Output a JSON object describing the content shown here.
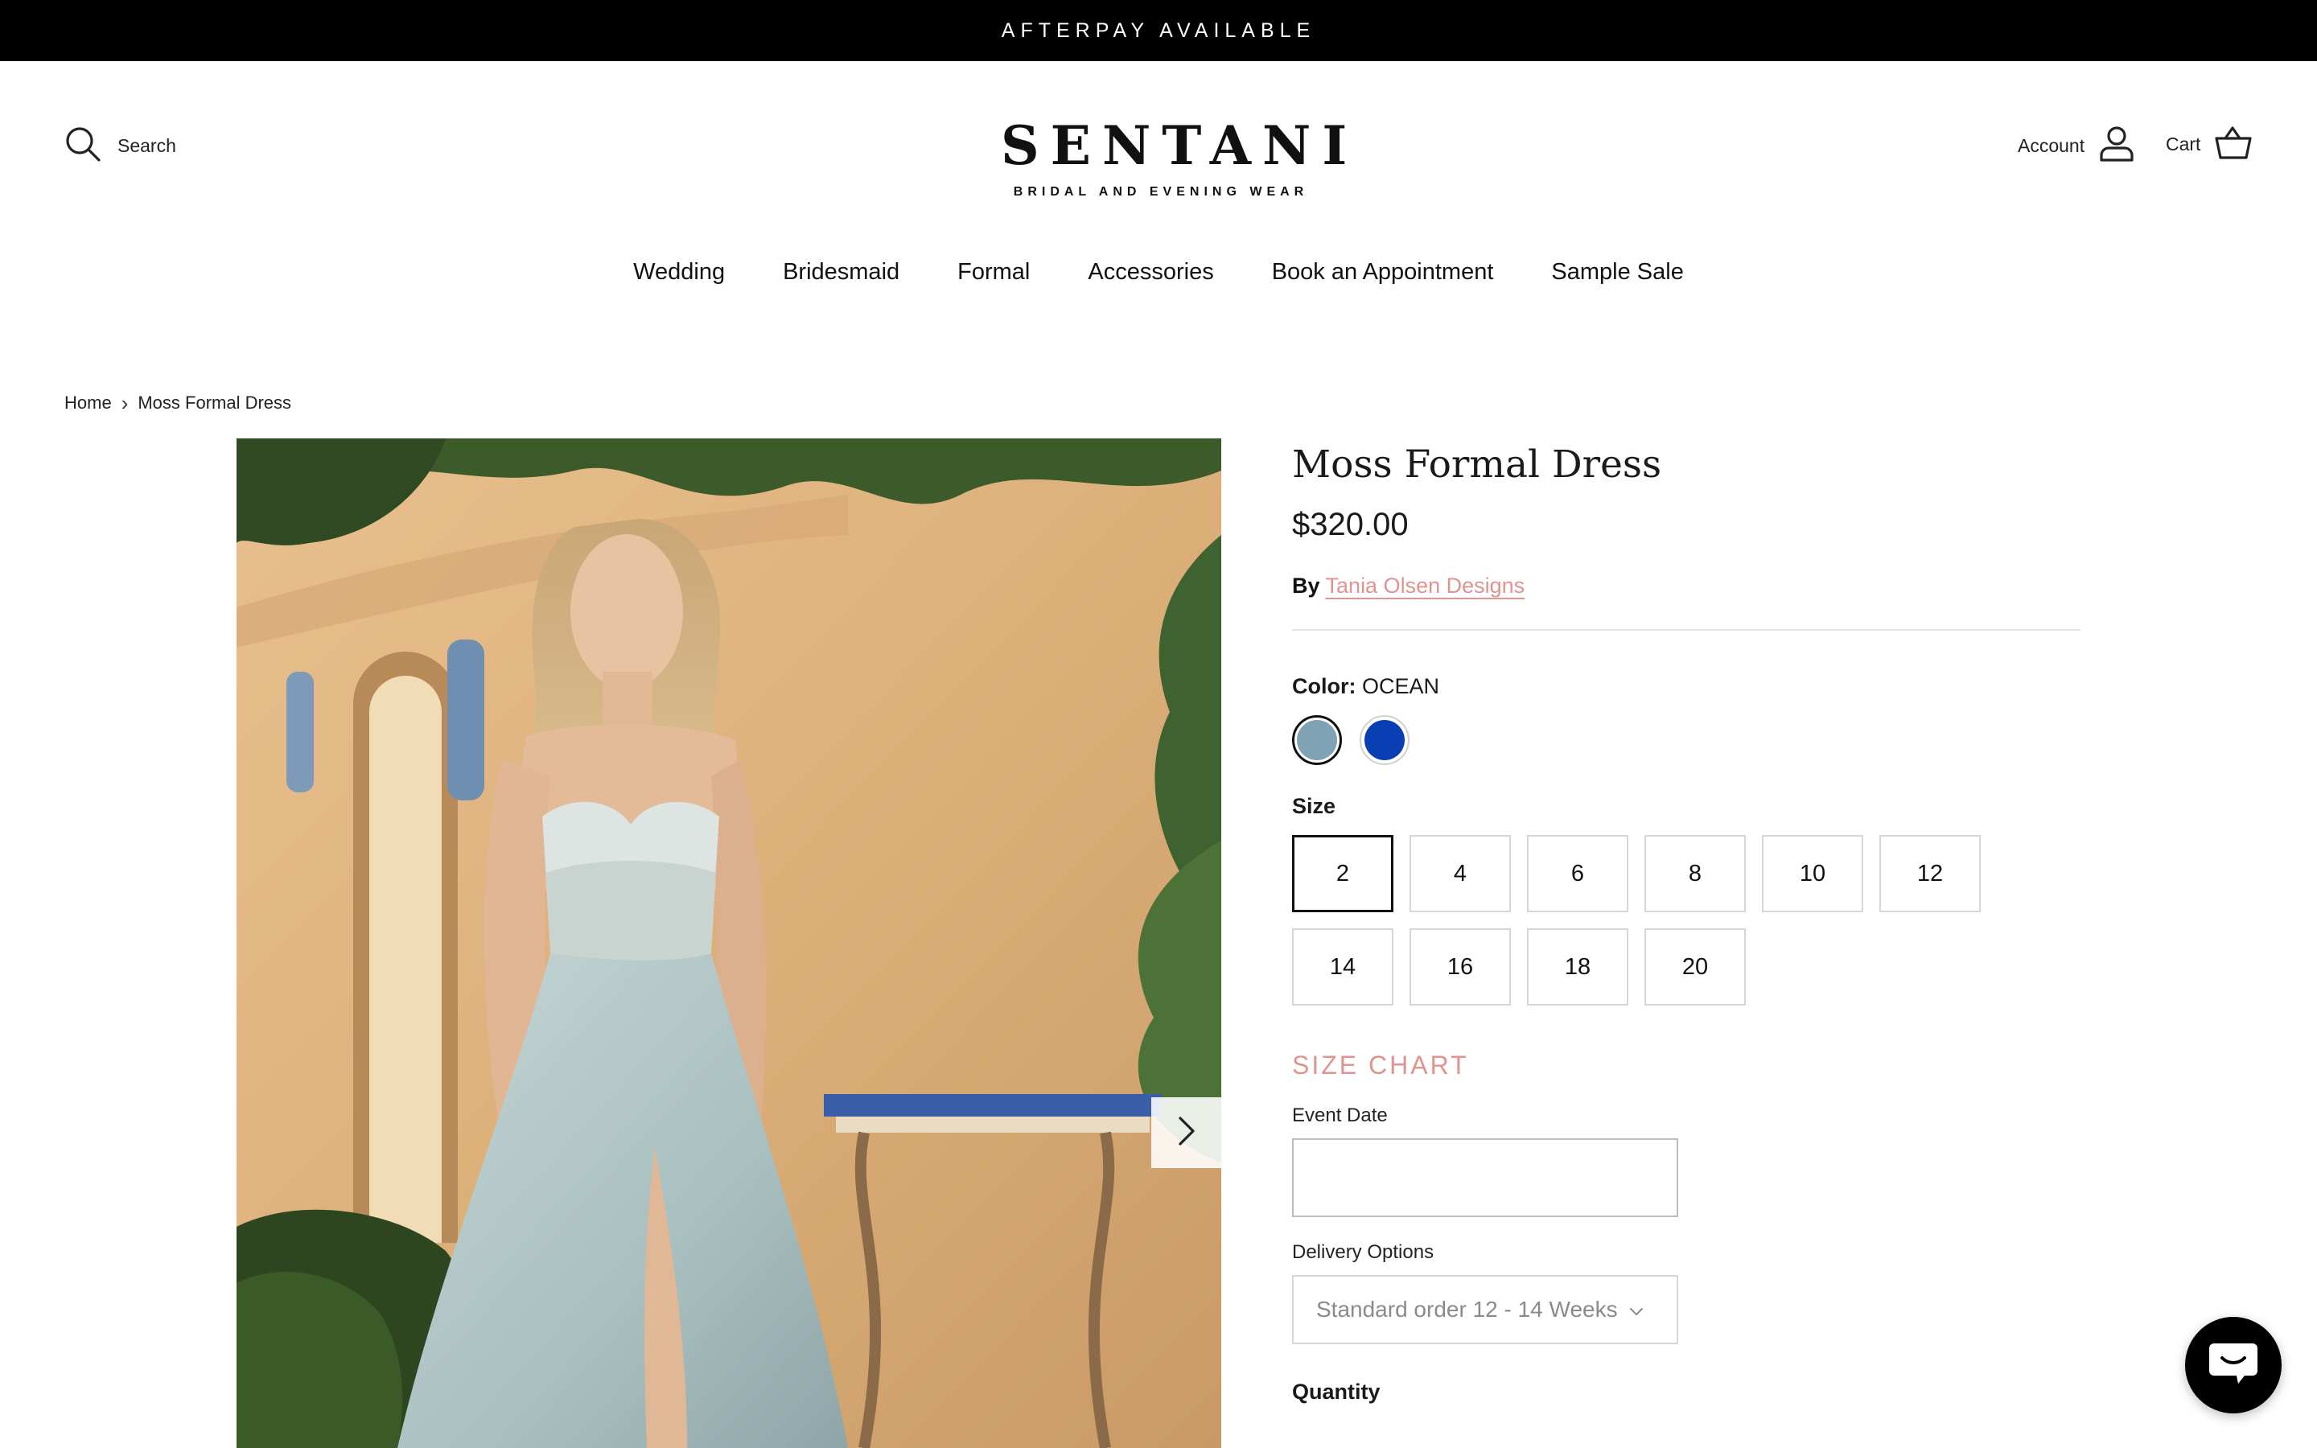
{
  "announcement": {
    "text": "AFTERPAY AVAILABLE"
  },
  "header": {
    "search_label": "Search",
    "logo_text": "SENTANI",
    "logo_tagline": "BRIDAL AND EVENING WEAR",
    "account_label": "Account",
    "cart_label": "Cart"
  },
  "nav": {
    "items": [
      {
        "label": "Wedding"
      },
      {
        "label": "Bridesmaid"
      },
      {
        "label": "Formal"
      },
      {
        "label": "Accessories"
      },
      {
        "label": "Book an Appointment"
      },
      {
        "label": "Sample Sale"
      }
    ]
  },
  "breadcrumb": {
    "home": "Home",
    "separator": "›",
    "current": "Moss Formal Dress"
  },
  "product": {
    "title": "Moss Formal Dress",
    "price": "$320.00",
    "vendor_prefix": "By",
    "vendor": "Tania Olsen Designs",
    "color_label": "Color:",
    "color_value": "OCEAN",
    "swatches": [
      {
        "name": "Ocean",
        "hex": "#7fa3b5",
        "selected": true
      },
      {
        "name": "Blue",
        "hex": "#0a3fb3",
        "selected": false
      }
    ],
    "size_label": "Size",
    "sizes": [
      "2",
      "4",
      "6",
      "8",
      "10",
      "12",
      "14",
      "16",
      "18",
      "20"
    ],
    "selected_size": "2",
    "size_chart_label": "SIZE CHART",
    "event_date_label": "Event Date",
    "event_date_value": "",
    "delivery_label": "Delivery Options",
    "delivery_value": "Standard order 12 - 14 Weeks",
    "quantity_label": "Quantity"
  },
  "colors": {
    "accent_link": "#e0948f",
    "announcement_bg": "#000000"
  },
  "icons": {
    "search": "search-icon",
    "account": "user-icon",
    "cart": "basket-icon",
    "next": "chevron-right-icon",
    "dropdown": "chevron-down-icon",
    "chat": "chat-icon"
  }
}
